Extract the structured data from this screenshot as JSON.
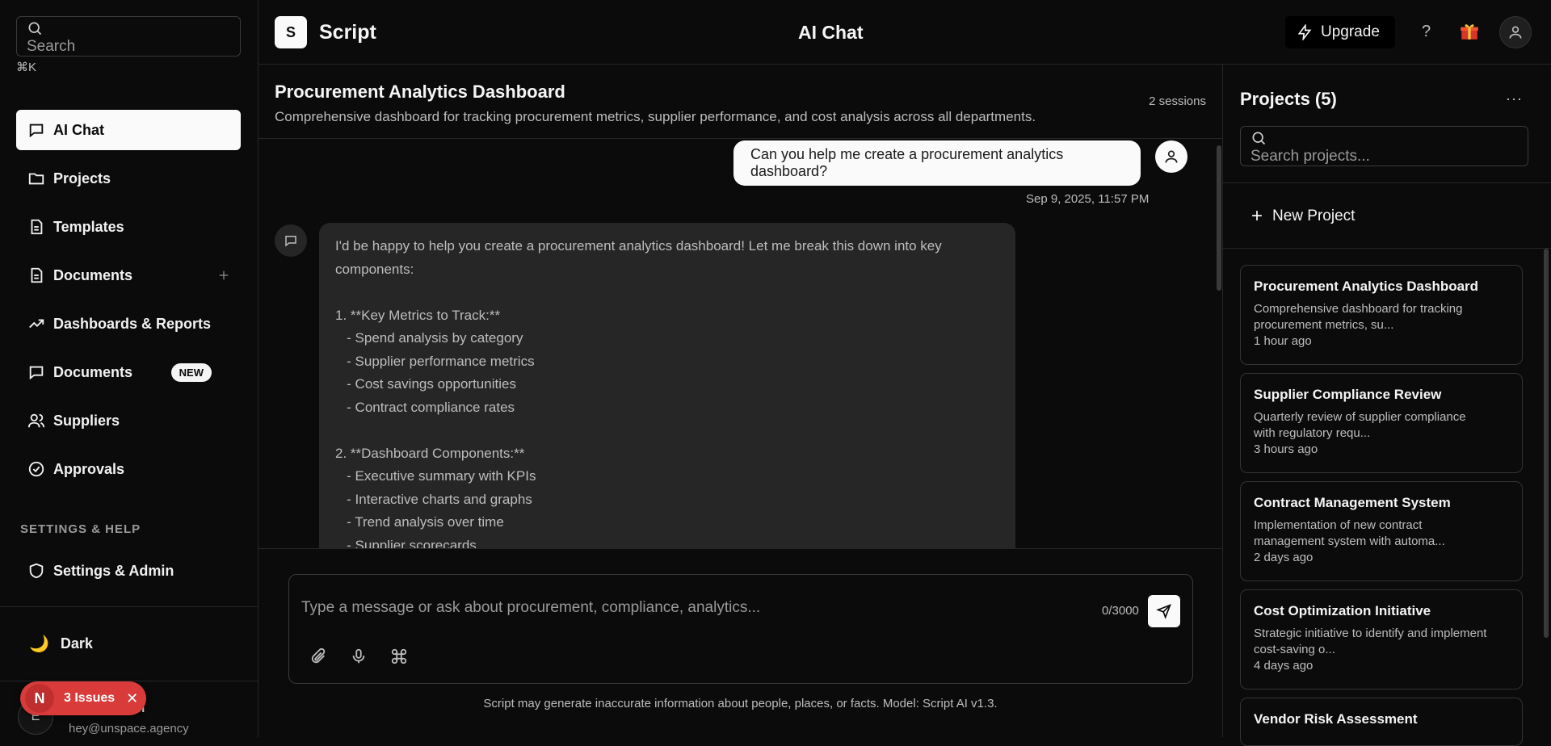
{
  "sidebar": {
    "search_placeholder": "Search",
    "search_shortcut": "⌘K",
    "nav": [
      {
        "label": "AI Chat",
        "icon": "chat-icon",
        "active": true
      },
      {
        "label": "Projects",
        "icon": "folder-icon"
      },
      {
        "label": "Templates",
        "icon": "file-icon"
      },
      {
        "label": "Documents",
        "icon": "document-icon"
      },
      {
        "label": "Dashboards & Reports",
        "icon": "trend-icon"
      },
      {
        "label": "Documents",
        "icon": "chat-icon",
        "badge": "NEW"
      },
      {
        "label": "Suppliers",
        "icon": "users-icon"
      },
      {
        "label": "Approvals",
        "icon": "check-circle-icon"
      }
    ],
    "section_label": "SETTINGS & HELP",
    "settings_label": "Settings & Admin",
    "theme_label": "Dark",
    "user": {
      "initial": "E",
      "name_fragment": "n",
      "email": "hey@unspace.agency"
    },
    "issues": {
      "letter": "N",
      "label": "3 Issues"
    }
  },
  "topbar": {
    "logo_letter": "S",
    "app_name": "Script",
    "page_title": "AI Chat",
    "upgrade_label": "Upgrade",
    "help_label": "?"
  },
  "main": {
    "project_title": "Procurement Analytics Dashboard",
    "project_desc": "Comprehensive dashboard for tracking procurement metrics, supplier performance, and cost analysis across all departments.",
    "sessions": "2 sessions",
    "user_message": "Can you help me create a procurement analytics dashboard?",
    "timestamp": "Sep 9, 2025, 11:57 PM",
    "assistant_lines": [
      "I'd be happy to help you create a procurement analytics dashboard! Let me break this down into key",
      "components:",
      "",
      "1. **Key Metrics to Track:**",
      "   - Spend analysis by category",
      "   - Supplier performance metrics",
      "   - Cost savings opportunities",
      "   - Contract compliance rates",
      "",
      "2. **Dashboard Components:**",
      "   - Executive summary with KPIs",
      "   - Interactive charts and graphs",
      "   - Trend analysis over time",
      "   - Supplier scorecards"
    ],
    "composer_placeholder": "Type a message or ask about procurement, compliance, analytics...",
    "char_count": "0/3000",
    "disclaimer": "Script may generate inaccurate information about people, places, or facts. Model: Script AI v1.3."
  },
  "projects": {
    "title": "Projects (5)",
    "more_label": "···",
    "search_placeholder": "Search projects...",
    "new_label": "New Project",
    "cards": [
      {
        "title": "Procurement Analytics Dashboard",
        "desc": "Comprehensive dashboard for tracking procurement metrics, su...",
        "age": "1 hour ago"
      },
      {
        "title": "Supplier Compliance Review",
        "desc": "Quarterly review of supplier compliance with regulatory requ...",
        "age": "3 hours ago"
      },
      {
        "title": "Contract Management System",
        "desc": "Implementation of new contract management system with automa...",
        "age": "2 days ago"
      },
      {
        "title": "Cost Optimization Initiative",
        "desc": "Strategic initiative to identify and implement cost-saving o...",
        "age": "4 days ago"
      },
      {
        "title": "Vendor Risk Assessment",
        "desc": "",
        "age": ""
      }
    ]
  },
  "colors": {
    "accent": "#fafafa",
    "background": "#0b0b0b",
    "issues": "#d93b3b"
  }
}
